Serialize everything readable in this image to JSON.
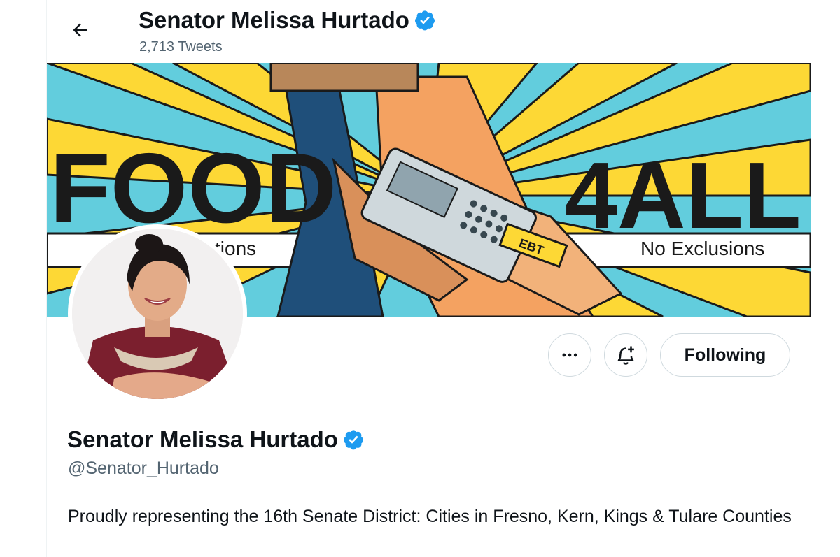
{
  "header": {
    "title": "Senator Melissa Hurtado",
    "tweet_count": "2,713 Tweets"
  },
  "banner": {
    "left_word": "FOOD",
    "right_word": "4ALL",
    "left_caption": "tions",
    "right_caption": "No Exclusions",
    "card_label": "EBT",
    "colors": {
      "yellow": "#fdd835",
      "teal": "#62cddd",
      "ink": "#1a1a1a"
    }
  },
  "actions": {
    "more_icon": "ellipsis-icon",
    "notify_icon": "bell-plus-icon",
    "follow_label": "Following"
  },
  "profile": {
    "name": "Senator Melissa Hurtado",
    "handle": "@Senator_Hurtado",
    "bio": "Proudly representing the 16th Senate District: Cities in Fresno, Kern, Kings & Tulare Counties",
    "verified_icon": "verified-badge-icon"
  },
  "colors": {
    "accent": "#1d9bf0",
    "secondary_text": "#536471",
    "border": "#cfd9de"
  }
}
